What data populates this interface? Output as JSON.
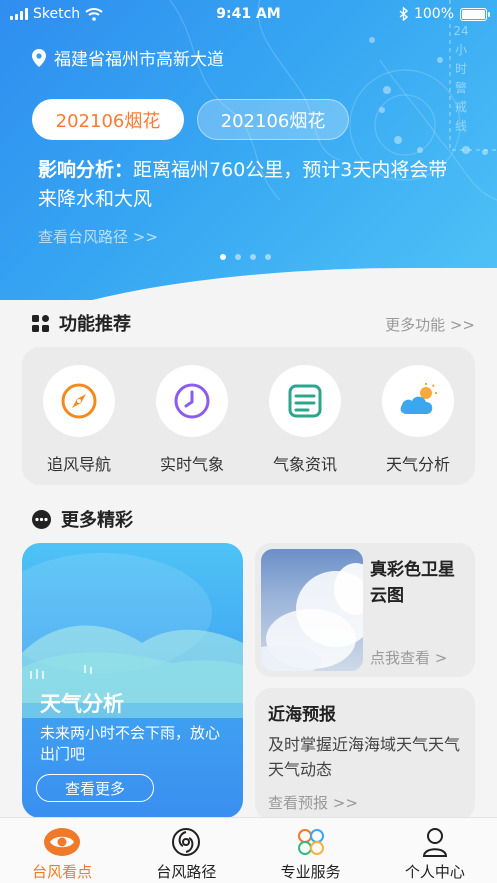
{
  "status_bar": {
    "carrier": "Sketch",
    "time": "9:41 AM",
    "battery": "100%"
  },
  "hero": {
    "location": "福建省福州市高新大道",
    "typhoon_tabs": [
      {
        "label": "202106烟花",
        "active": true
      },
      {
        "label": "202106烟花",
        "active": false
      }
    ],
    "impact_label": "影响分析：",
    "impact_text": "距离福州760公里，预计3天内将会带来降水和大风",
    "route_link": "查看台风路径 >>",
    "carousel_total": 4,
    "carousel_active": 1,
    "map_labels": [
      "24",
      "小",
      "时",
      "警",
      "戒",
      "线"
    ]
  },
  "features": {
    "title": "功能推荐",
    "more": "更多功能 >>",
    "items": [
      {
        "label": "追风导航",
        "icon": "compass-icon"
      },
      {
        "label": "实时气象",
        "icon": "clock-icon"
      },
      {
        "label": "气象资讯",
        "icon": "news-icon"
      },
      {
        "label": "天气分析",
        "icon": "weather-icon"
      }
    ]
  },
  "more_section": {
    "title": "更多精彩",
    "weather_card": {
      "title": "天气分析",
      "desc": "未来两小时不会下雨，放心出门吧",
      "button": "查看更多"
    },
    "satellite_card": {
      "title": "真彩色卫星云图",
      "link": "点我查看 >"
    },
    "sea_card": {
      "title": "近海预报",
      "desc": "及时掌握近海海域天气天气天气动态",
      "link": "查看预报 >>"
    }
  },
  "tabbar": {
    "items": [
      {
        "label": "台风看点",
        "icon": "eye-icon",
        "active": true
      },
      {
        "label": "台风路径",
        "icon": "typhoon-icon",
        "active": false
      },
      {
        "label": "专业服务",
        "icon": "flower-icon",
        "active": false
      },
      {
        "label": "个人中心",
        "icon": "person-icon",
        "active": false
      }
    ]
  },
  "colors": {
    "accent": "#f07a2a",
    "hero_blue": "#36a6f2",
    "card_bg": "#ebebeb"
  }
}
